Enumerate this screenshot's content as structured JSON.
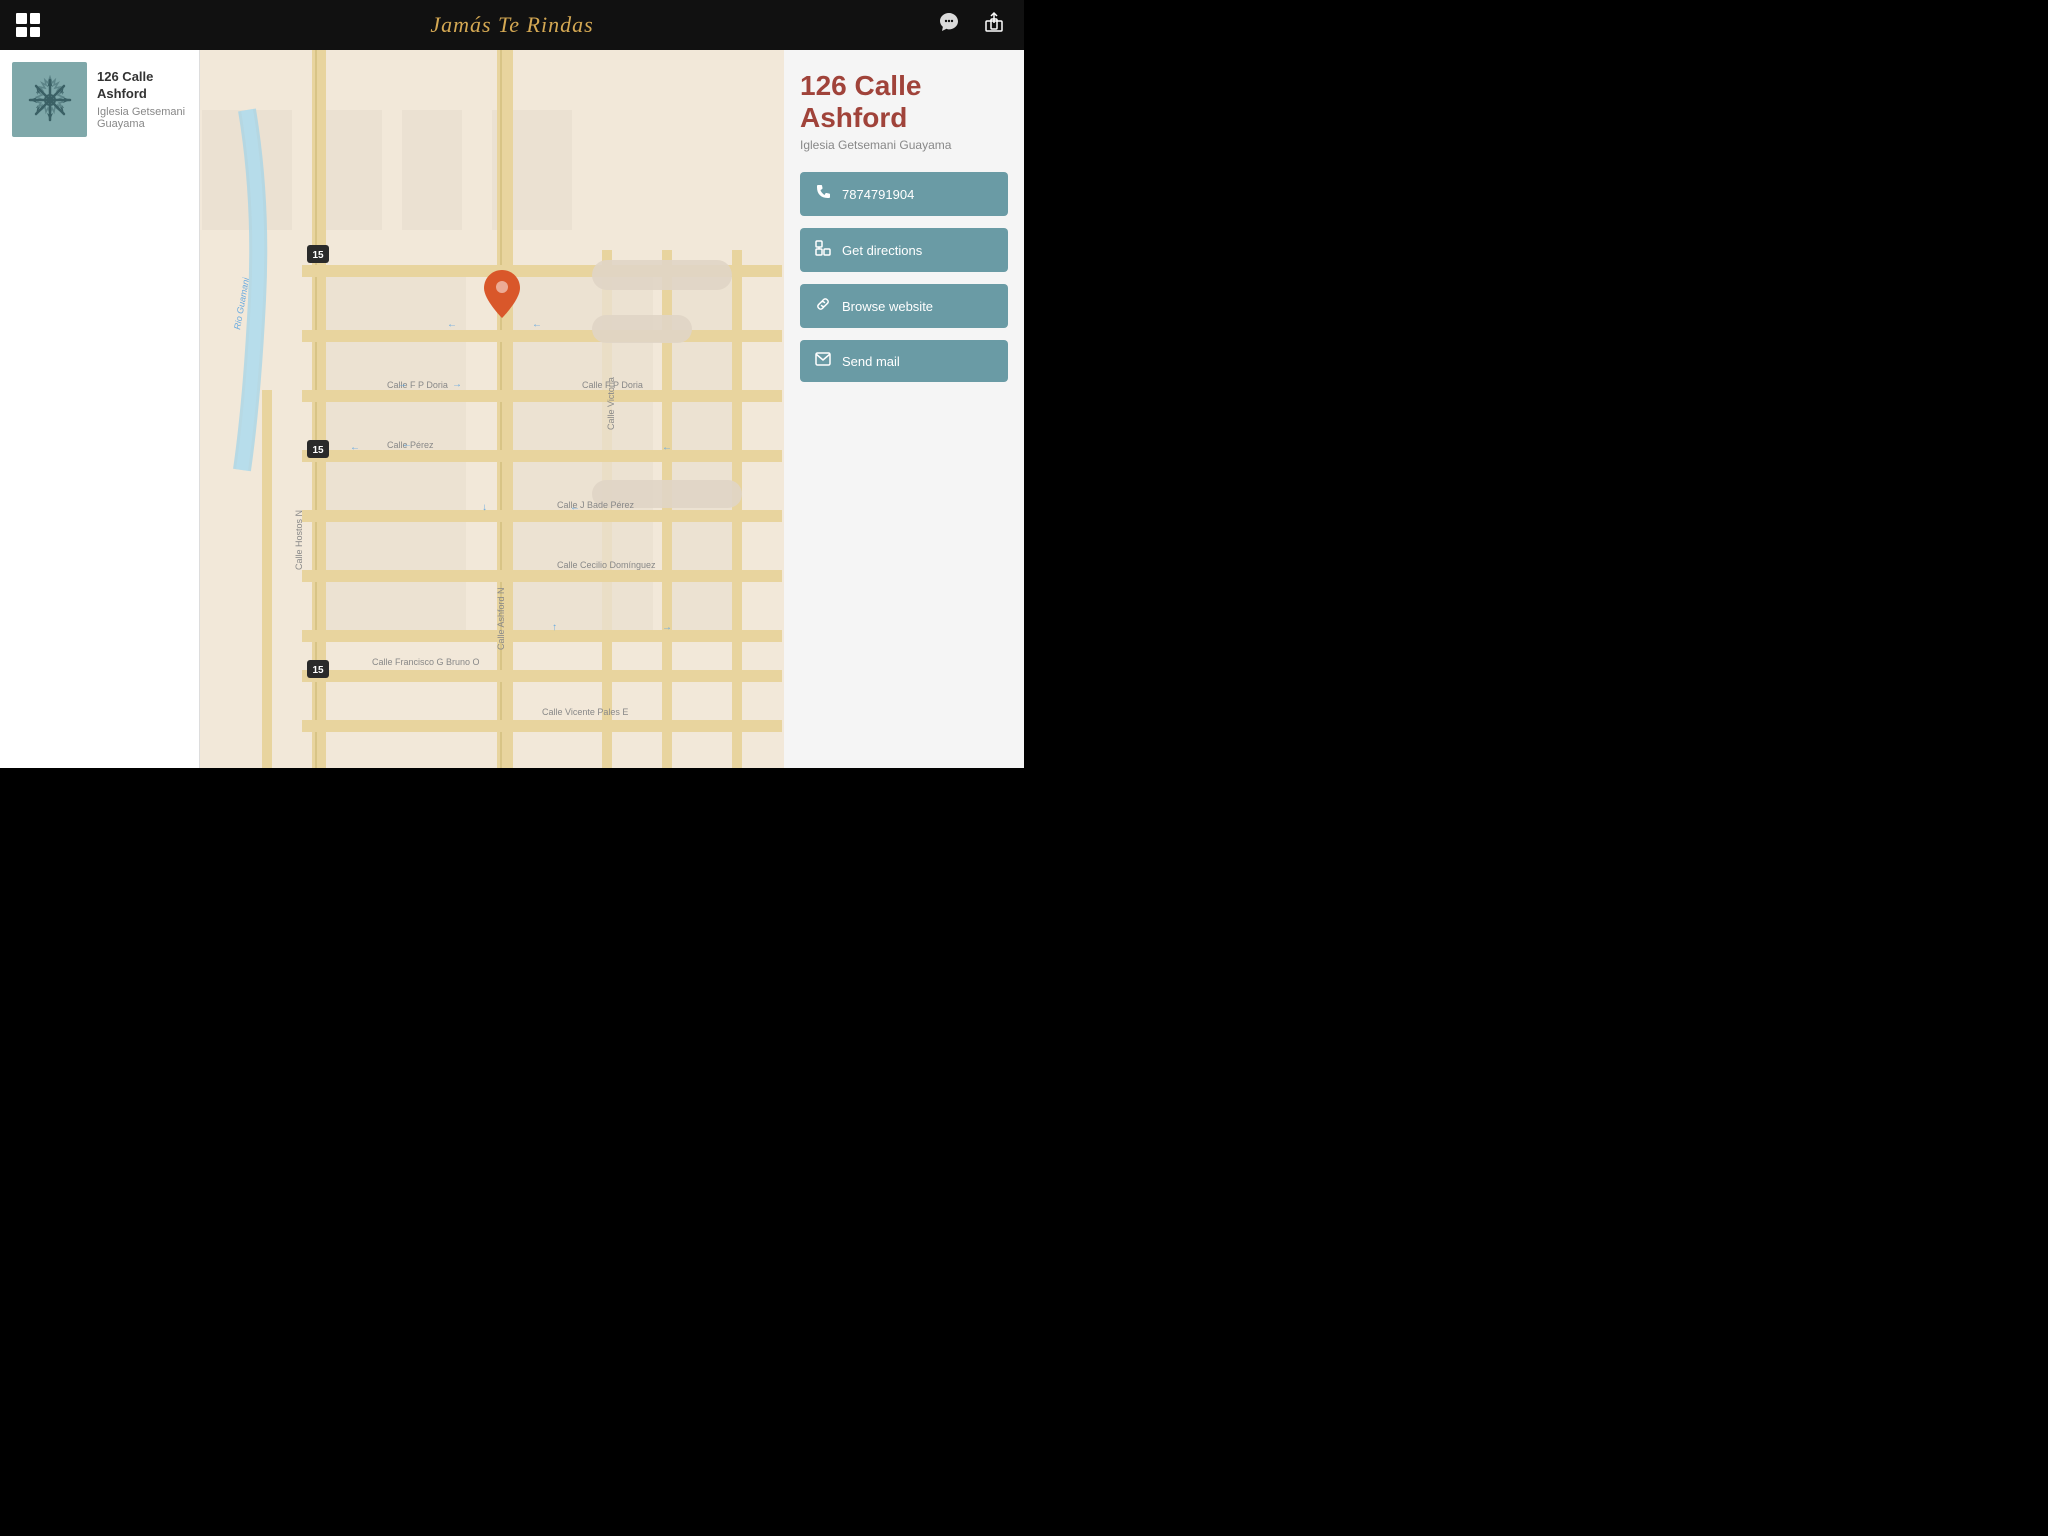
{
  "app": {
    "title": "Jamás Te Rindas",
    "grid_icon": "grid-icon",
    "chat_icon": "chat-icon",
    "share_icon": "share-icon"
  },
  "place_card": {
    "name": "126 Calle Ashford",
    "subtitle": "Iglesia Getsemani Guayama",
    "thumb_alt": "place-thumbnail"
  },
  "right_panel": {
    "title": "126 Calle Ashford",
    "subtitle": "Iglesia Getsemani Guayama",
    "actions": [
      {
        "id": "phone",
        "icon": "📞",
        "label": "7874791904"
      },
      {
        "id": "directions",
        "icon": "🗺",
        "label": "Get directions"
      },
      {
        "id": "website",
        "icon": "🔗",
        "label": "Browse website"
      },
      {
        "id": "mail",
        "icon": "✉",
        "label": "Send mail"
      }
    ]
  },
  "map": {
    "pin_color": "#d9572a",
    "road_color": "#e8d49e",
    "road_dark": "#c8b46e",
    "background": "#f2e8d9",
    "water_color": "#a8d4e6",
    "street_labels": [
      "Rio Guamani",
      "Calle Hostos N",
      "Calle F P Doria",
      "Calle Pérez",
      "Calle J Bade Pérez",
      "Calle Ashford N",
      "Calle Cecilio Domínguez",
      "Calle Francisco G Bruno O",
      "Calle Vicente Pales E",
      "Calle Victoria"
    ],
    "route_badge": "15"
  }
}
